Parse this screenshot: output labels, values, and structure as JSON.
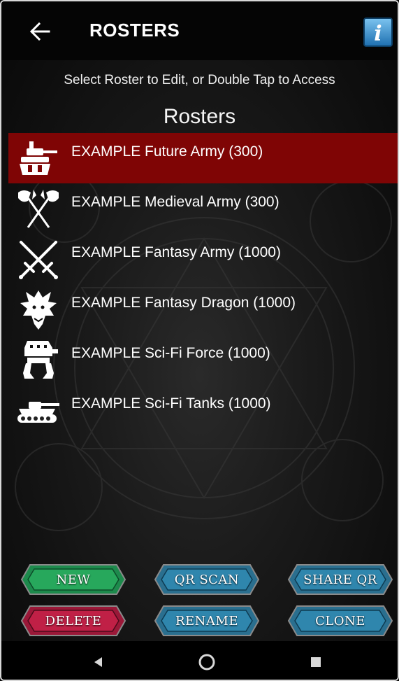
{
  "header": {
    "title": "ROSTERS",
    "back_icon": "arrow-left-icon",
    "info_icon": "info-icon",
    "info_letter": "i"
  },
  "subtitle": "Select Roster to Edit, or Double Tap to Access",
  "section_title": "Rosters",
  "rosters": [
    {
      "label": "EXAMPLE Future Army (300)",
      "icon": "mech-head-icon",
      "selected": true
    },
    {
      "label": "EXAMPLE Medieval Army (300)",
      "icon": "crossed-axes-icon",
      "selected": false
    },
    {
      "label": "EXAMPLE Fantasy Army (1000)",
      "icon": "crossed-swords-icon",
      "selected": false
    },
    {
      "label": "EXAMPLE Fantasy Dragon (1000)",
      "icon": "dragon-head-icon",
      "selected": false
    },
    {
      "label": "EXAMPLE Sci-Fi Force (1000)",
      "icon": "walker-mech-icon",
      "selected": false
    },
    {
      "label": "EXAMPLE Sci-Fi Tanks (1000)",
      "icon": "tank-icon",
      "selected": false
    }
  ],
  "buttons": {
    "new": "NEW",
    "qr_scan": "QR SCAN",
    "share_qr": "SHARE QR",
    "delete": "DELETE",
    "rename": "RENAME",
    "clone": "CLONE"
  },
  "colors": {
    "selected_row": "#7f0505",
    "new_button": "#1f8a4a",
    "blue_button": "#2a6f8f",
    "delete_button": "#a01a3a",
    "info_button": "#2f8fd0"
  }
}
